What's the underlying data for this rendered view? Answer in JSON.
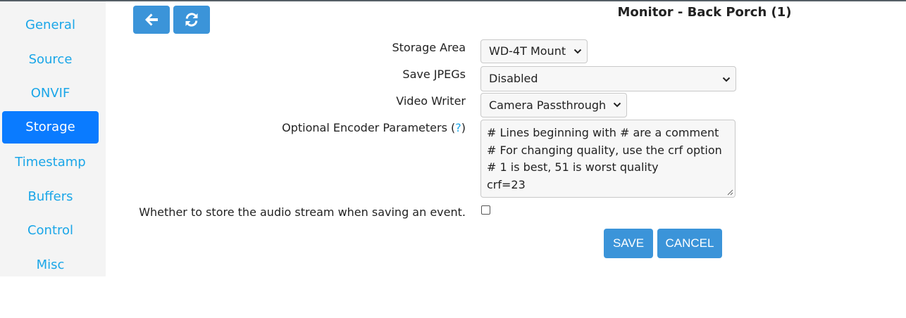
{
  "header": {
    "title": "Monitor - Back Porch (1)"
  },
  "toolbar": {
    "back_icon": "arrow-left-icon",
    "refresh_icon": "refresh-icon"
  },
  "sidebar": {
    "items": [
      {
        "label": "General",
        "active": false
      },
      {
        "label": "Source",
        "active": false
      },
      {
        "label": "ONVIF",
        "active": false
      },
      {
        "label": "Storage",
        "active": true
      },
      {
        "label": "Timestamp",
        "active": false
      },
      {
        "label": "Buffers",
        "active": false
      },
      {
        "label": "Control",
        "active": false
      },
      {
        "label": "Misc",
        "active": false
      }
    ]
  },
  "form": {
    "storage_area": {
      "label": "Storage Area",
      "value": "WD-4T Mount"
    },
    "save_jpegs": {
      "label": "Save JPEGs",
      "value": "Disabled"
    },
    "video_writer": {
      "label": "Video Writer",
      "value": "Camera Passthrough"
    },
    "encoder_params": {
      "label": "Optional Encoder Parameters (",
      "help": "?",
      "label_close": ")",
      "lines": [
        "# Lines beginning with # are a comment",
        "# For changing quality, use the crf option",
        "# 1 is best, 51 is worst quality",
        "crf=23"
      ]
    },
    "store_audio": {
      "label": "Whether to store the audio stream when saving an event.",
      "checked": false
    }
  },
  "actions": {
    "save_label": "SAVE",
    "cancel_label": "CANCEL"
  },
  "colors": {
    "accent": "#3b94d9",
    "nav_link": "#1aa6e8",
    "nav_active": "#0a7bff"
  }
}
